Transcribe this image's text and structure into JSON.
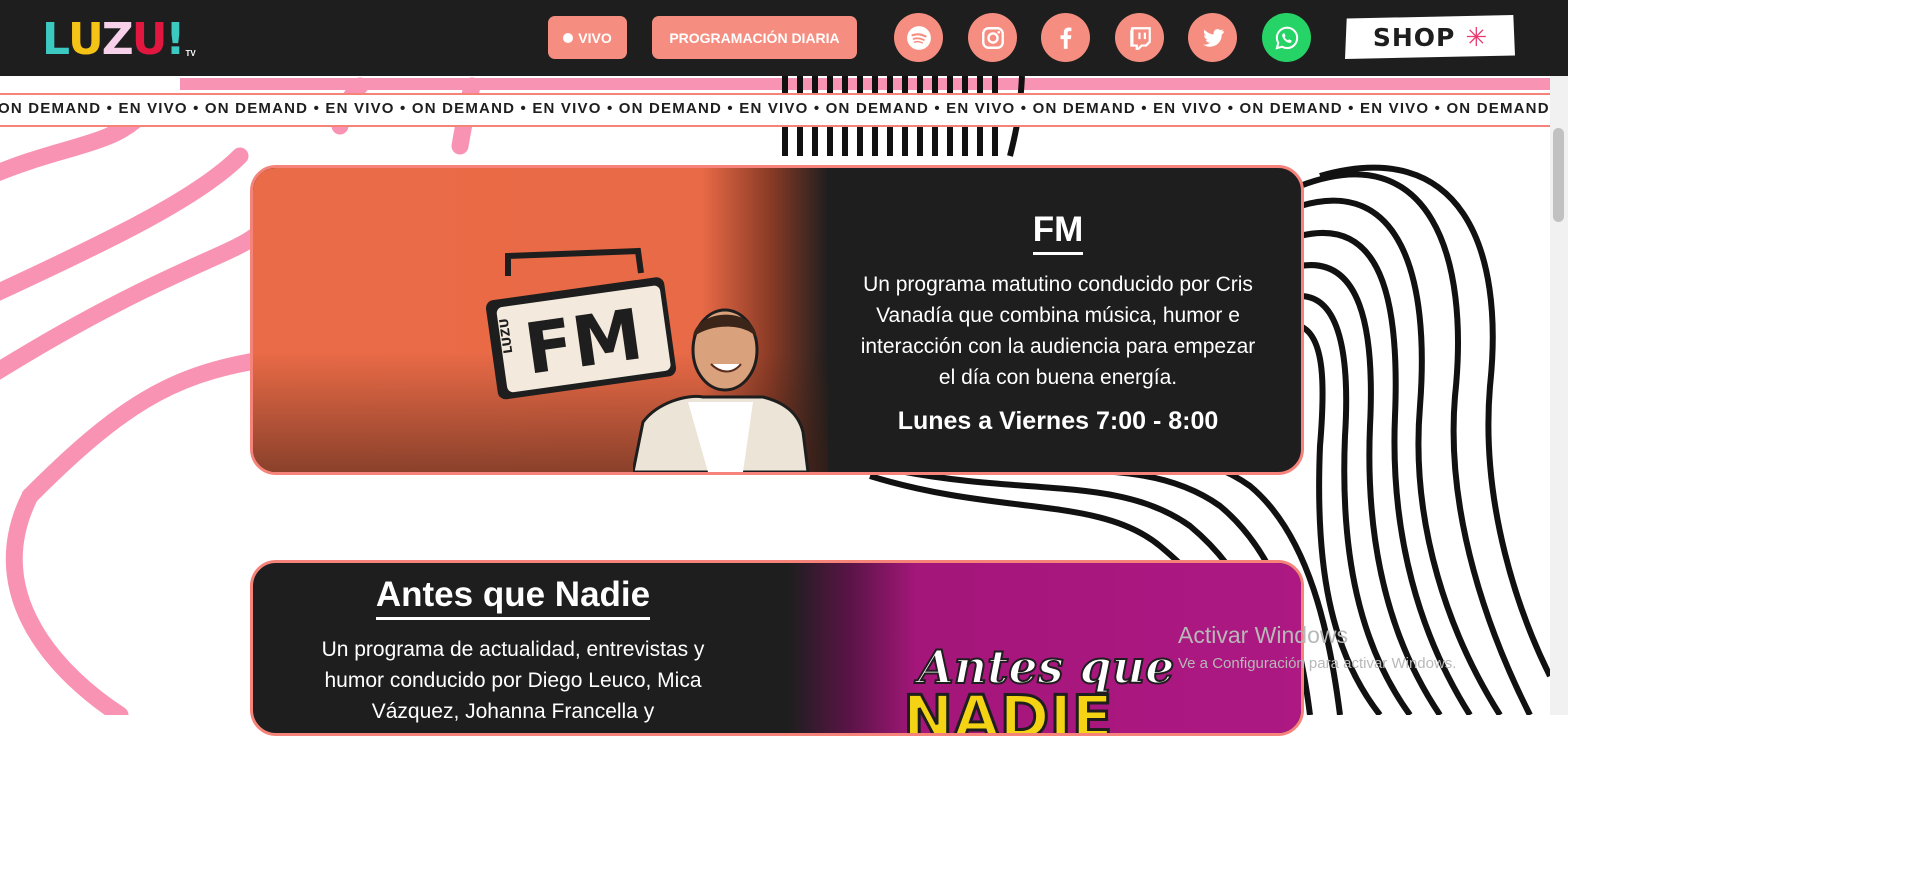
{
  "header": {
    "logo": {
      "letters": [
        "L",
        "U",
        "Z",
        "U",
        "!"
      ],
      "colors": [
        "#3cc9c2",
        "#f4c315",
        "#f7d1ea",
        "#e2173f",
        "#3cc9c2"
      ],
      "suffix": "TV"
    },
    "live_label": "VIVO",
    "schedule_label": "PROGRAMACIÓN DIARIA",
    "social_icons": [
      "spotify-icon",
      "instagram-icon",
      "facebook-icon",
      "twitch-icon",
      "twitter-icon",
      "whatsapp-icon"
    ],
    "shop_label": "SHOP",
    "colors": {
      "accent": "#f58e80",
      "bar": "#1e1e1e",
      "whatsapp": "#25d366"
    }
  },
  "ticker": {
    "text": "ON DEMAND • EN VIVO • ON DEMAND • EN VIVO • ON DEMAND • EN VIVO • ON DEMAND • EN VIVO • ON DEMAND • EN VIVO • ON DEMAND • EN VIVO • ON DEMAND • EN VIVO • ON DEMAND • EN VI"
  },
  "programs": [
    {
      "title": "FM",
      "description": "Un programa matutino conducido por Cris Vanadía que combina música, humor e interacción con la audiencia para empezar el día con buena energía.",
      "schedule": "Lunes a Viernes 7:00 - 8:00",
      "art_label": "FM",
      "art_brand": "LUZU"
    },
    {
      "title": "Antes que Nadie",
      "description": "Un programa de actualidad, entrevistas y humor conducido por Diego Leuco, Mica Vázquez, Johanna Francella y",
      "art_label": "Antes que",
      "art_label_2": "NADIE"
    }
  ],
  "watermark": {
    "title": "Activar Windows",
    "subtitle": "Ve a Configuración para activar Windows."
  }
}
